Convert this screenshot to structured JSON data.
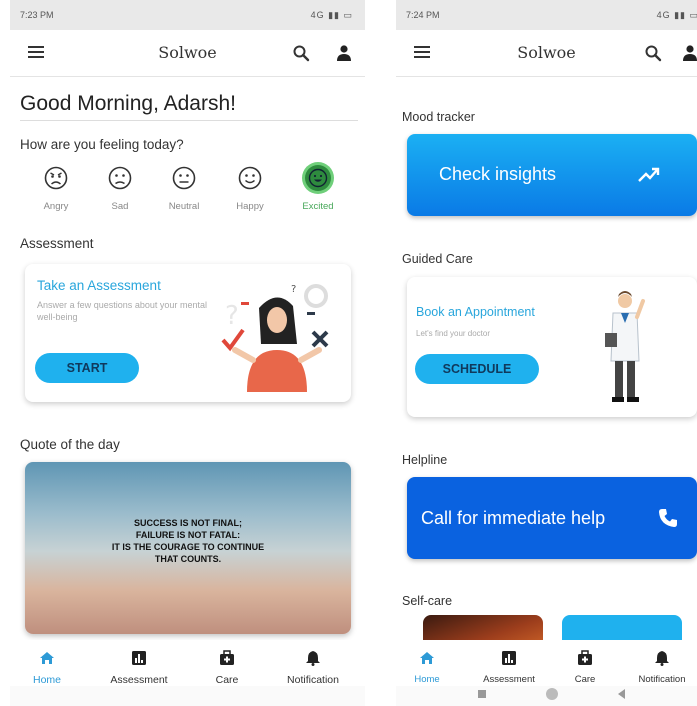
{
  "colors": {
    "accent": "#1fb1ee",
    "primary_blue": "#0a62e0",
    "excited_green": "#2e8b3e",
    "title_blue": "#29a6dc"
  },
  "left": {
    "status": {
      "time": "7:23 PM",
      "indicators": "4G ▮▮ ▭"
    },
    "appbar": {
      "title": "Solwoe",
      "menu_icon": "menu-icon",
      "search_icon": "search-icon",
      "profile_icon": "person-icon"
    },
    "greeting": "Good Morning, Adarsh!",
    "mood_question": "How are you feeling today?",
    "moods": [
      {
        "label": "Angry"
      },
      {
        "label": "Sad"
      },
      {
        "label": "Neutral"
      },
      {
        "label": "Happy"
      },
      {
        "label": "Excited"
      }
    ],
    "selected_mood": "Excited",
    "assessment": {
      "section_title": "Assessment",
      "card_title": "Take an Assessment",
      "description": "Answer a few questions about your mental well-being",
      "button": "START"
    },
    "quote": {
      "section_title": "Quote of the day",
      "lines": [
        "SUCCESS IS NOT FINAL;",
        "FAILURE IS NOT FATAL:",
        "IT IS THE COURAGE TO CONTINUE",
        "THAT COUNTS."
      ]
    },
    "nav": [
      {
        "label": "Home",
        "icon": "home-icon"
      },
      {
        "label": "Assessment",
        "icon": "assessment-icon"
      },
      {
        "label": "Care",
        "icon": "medical-bag-icon"
      },
      {
        "label": "Notification",
        "icon": "bell-icon"
      }
    ],
    "active_nav": "Home"
  },
  "right": {
    "status": {
      "time": "7:24 PM",
      "indicators": "4G ▮▮ ▭"
    },
    "appbar": {
      "title": "Solwoe"
    },
    "mood_tracker": {
      "section_title": "Mood tracker",
      "button": "Check insights",
      "icon": "trend-up-icon"
    },
    "guided_care": {
      "section_title": "Guided Care",
      "card_title": "Book an Appointment",
      "subtitle": "Let's find your doctor",
      "button": "SCHEDULE"
    },
    "helpline": {
      "section_title": "Helpline",
      "button": "Call for immediate help",
      "icon": "phone-icon"
    },
    "self_care": {
      "section_title": "Self-care"
    },
    "nav": [
      {
        "label": "Home"
      },
      {
        "label": "Assessment"
      },
      {
        "label": "Care"
      },
      {
        "label": "Notification"
      }
    ],
    "active_nav": "Home"
  }
}
